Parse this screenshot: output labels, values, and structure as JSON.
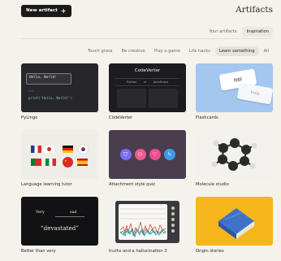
{
  "header": {
    "new_artifact_label": "New artifact",
    "title": "Artifacts"
  },
  "top_tabs": [
    {
      "label": "Your artifacts",
      "active": false
    },
    {
      "label": "Inspiration",
      "active": true
    }
  ],
  "filters": [
    {
      "label": "Touch grass",
      "active": false
    },
    {
      "label": "Be creative",
      "active": false
    },
    {
      "label": "Play a game",
      "active": false
    },
    {
      "label": "Life hacks",
      "active": false
    },
    {
      "label": "Learn something",
      "active": true
    },
    {
      "label": "All",
      "active": false
    }
  ],
  "cards": {
    "pylingo": {
      "caption": "PyLingo",
      "input_text": "Hello, World!",
      "code": "print('Hello, World!')",
      "hint": "&gt;&gt;&gt;"
    },
    "codeverter": {
      "caption": "CodeVerter",
      "header": "CodeVerter",
      "from_lang": "Python",
      "to_lang": "JavaScript"
    },
    "flashcards": {
      "caption": "Flashcards",
      "front": "你好",
      "back": "hola"
    },
    "language_tutor": {
      "caption": "Language learning tutor"
    },
    "quiz": {
      "caption": "Attachment style quiz"
    },
    "molecule": {
      "caption": "Molecule studio"
    },
    "better": {
      "caption": "Better than very",
      "word1": "Very",
      "word2": "sad",
      "result": "“devastated”"
    },
    "truths": {
      "caption": "truths and a hallucination 3"
    },
    "origin": {
      "caption": "Origin stories"
    }
  },
  "colors": {
    "background": "#f4f2ea",
    "button_dark": "#1a1a18",
    "flashcards_bg": "#a3c7ee",
    "quiz_bg": "#4a3d4d",
    "origin_bg": "#f7b61b"
  }
}
